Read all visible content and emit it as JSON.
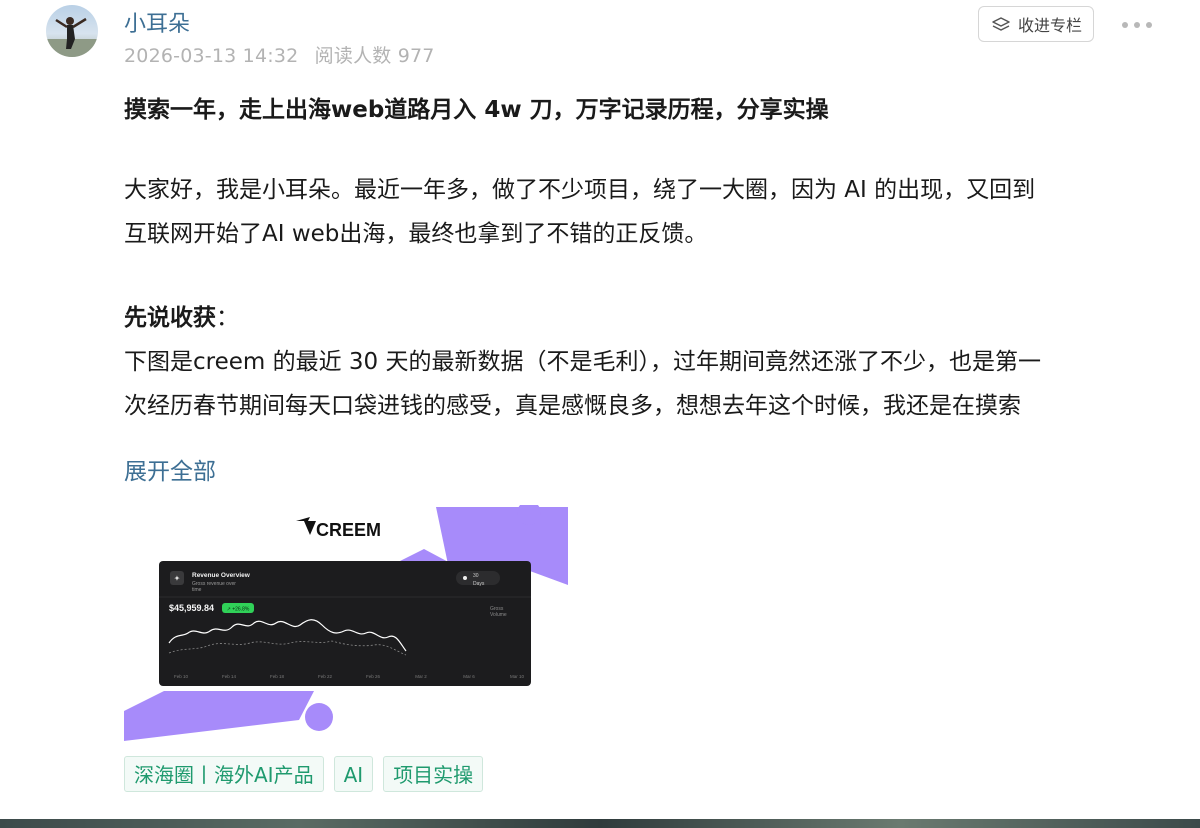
{
  "post": {
    "author": "小耳朵",
    "date": "2026-03-13 14:32",
    "reads": "阅读人数 977",
    "collect_label": "收进专栏",
    "title": "摸索一年，走上出海web道路月入 4w 刀，万字记录历程，分享实操",
    "para1_line1": "大家好，我是小耳朵。最近一年多，做了不少项目，绕了一大圈，因为 AI 的出现，又回到",
    "para1_line2": "互联网开始了AI web出海，最终也拿到了不错的正反馈。",
    "para2_heading": "先说收获",
    "para2_colon": "：",
    "para2_line1": "下图是creem 的最近 30 天的最新数据（不是毛利），过年期间竟然还涨了不少，也是第一",
    "para2_line2": "次经历春节期间每天口袋进钱的感受，真是感慨良多，想想去年这个时候，我还是在摸索",
    "expand_label": "展开全部"
  },
  "image": {
    "brand": "CREEM",
    "card_title": "Revenue Overview",
    "card_subtitle1": "Gross revenue over",
    "card_subtitle2": "time",
    "period_value": "30",
    "period_unit": "Days",
    "amount": "$45,959.84",
    "change": "↗ +26.8%",
    "legend1": "Gross",
    "legend2": "Volume",
    "x_ticks": [
      "Feb 10",
      "Feb 14",
      "Feb 18",
      "Feb 22",
      "Feb 26",
      "Mar 2",
      "Mar 6",
      "Mar 10"
    ]
  },
  "tags": [
    "深海圈丨海外AI产品",
    "AI",
    "项目实操"
  ],
  "colors": {
    "link": "#3d6f94",
    "tag_text": "#1f9a6e",
    "purple": "#a78bfa",
    "card_bg": "#1c1c1e"
  }
}
